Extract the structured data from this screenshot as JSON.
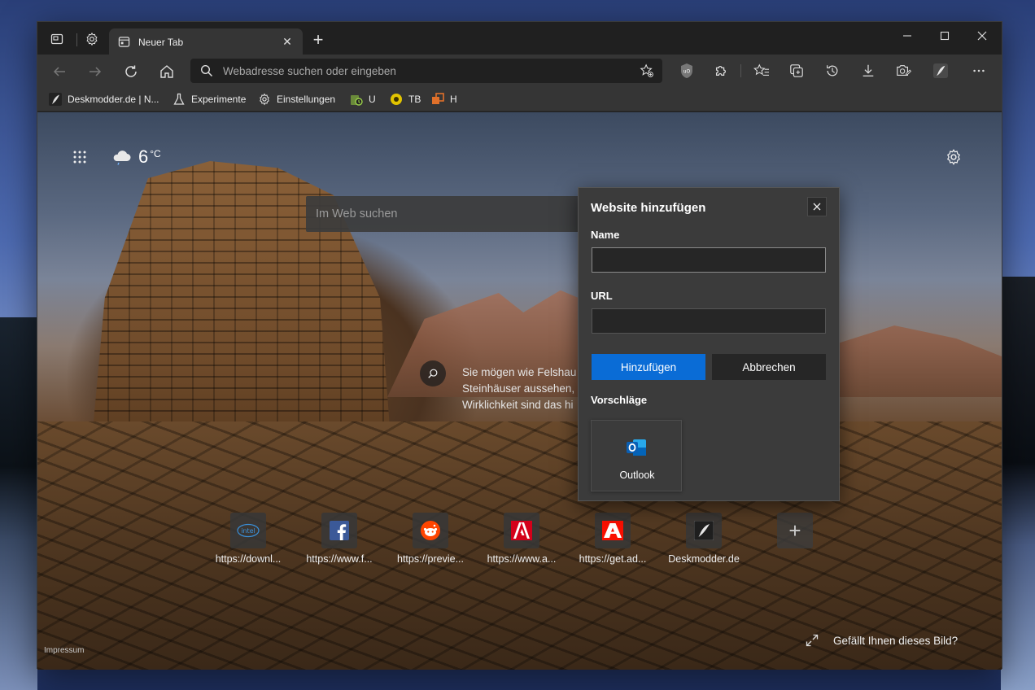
{
  "window": {
    "tab_title": "Neuer Tab",
    "new_tab_symbol": "+"
  },
  "toolbar": {
    "address_placeholder": "Webadresse suchen oder eingeben"
  },
  "bookmarks": [
    {
      "label": "Deskmodder.de | N...",
      "icon": "quill-icon"
    },
    {
      "label": "Experimente",
      "icon": "flask-icon"
    },
    {
      "label": "Einstellungen",
      "icon": "gear-icon"
    },
    {
      "label": "U",
      "icon": "u-icon"
    },
    {
      "label": "TB",
      "icon": "tb-icon"
    },
    {
      "label": "H",
      "icon": "h-icon"
    }
  ],
  "newtab": {
    "weather_temp": "6",
    "weather_unit": "°C",
    "search_placeholder": "Im Web suchen",
    "caption": [
      "Sie mögen wie Felshau",
      "Steinhäuser aussehen,",
      "Wirklichkeit sind das hi"
    ],
    "impressum": "Impressum",
    "like_text": "Gefällt Ihnen dieses Bild?",
    "tiles": [
      {
        "label": "https://downl...",
        "icon": "intel-icon"
      },
      {
        "label": "https://www.f...",
        "icon": "facebook-icon"
      },
      {
        "label": "https://previe...",
        "icon": "reddit-icon"
      },
      {
        "label": "https://www.a...",
        "icon": "adobe-icon"
      },
      {
        "label": "https://get.ad...",
        "icon": "adobe-icon"
      },
      {
        "label": "Deskmodder.de",
        "icon": "quill-icon"
      }
    ],
    "add_tile_symbol": "+"
  },
  "dialog": {
    "title": "Website hinzufügen",
    "name_label": "Name",
    "name_value": "",
    "url_label": "URL",
    "url_value": "",
    "add_button": "Hinzufügen",
    "cancel_button": "Abbrechen",
    "suggestions_label": "Vorschläge",
    "suggestion": {
      "label": "Outlook",
      "icon": "outlook-icon"
    }
  },
  "colors": {
    "accent": "#0a6cd6",
    "browser_bg": "#202020",
    "toolbar_bg": "#353535",
    "dialog_bg": "#3b3b3b"
  }
}
